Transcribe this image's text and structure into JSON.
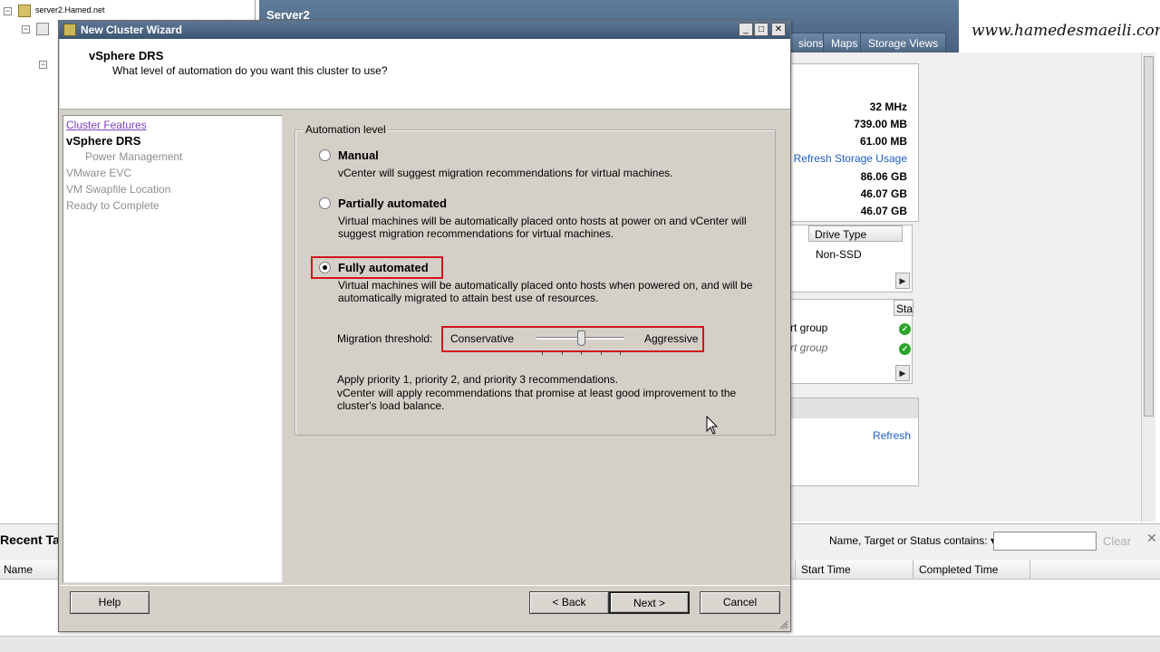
{
  "background": {
    "tree": {
      "root_label": "server2.Hamed.net"
    },
    "server_title": "Server2",
    "tabs": [
      "sions",
      "Maps",
      "Storage Views"
    ],
    "watermark": "www.hamedesmaeili.com",
    "resources": [
      "32 MHz",
      "739.00 MB",
      "61.00 MB"
    ],
    "refresh_storage_usage": "Refresh Storage Usage",
    "storage": [
      "86.06 GB",
      "46.07 GB",
      "46.07 GB"
    ],
    "drive_type_header": "Drive Type",
    "drive_type_value": "Non-SSD",
    "status_header": "Sta",
    "port_groups": [
      "rt group",
      "rt group"
    ],
    "refresh_link": "Refresh",
    "recent_tasks": {
      "title": "Recent Tas",
      "filter_label": "Name, Target or Status contains: ▾",
      "filter_value": "",
      "clear_label": "Clear",
      "columns": [
        "Name",
        "Start Time",
        "Completed Time"
      ]
    }
  },
  "wizard": {
    "title": "New Cluster Wizard",
    "window_buttons": {
      "minimize": "_",
      "maximize": "□",
      "close": "✕"
    },
    "header": {
      "title": "vSphere DRS",
      "subtitle": "What level of automation do you want this cluster to use?"
    },
    "steps": [
      {
        "label": "Cluster Features",
        "state": "done"
      },
      {
        "label": "vSphere DRS",
        "state": "current"
      },
      {
        "label": "Power Management",
        "state": "future"
      },
      {
        "label": "VMware EVC",
        "state": "future"
      },
      {
        "label": "VM Swapfile Location",
        "state": "future"
      },
      {
        "label": "Ready to Complete",
        "state": "future"
      }
    ],
    "automation": {
      "group_label": "Automation level",
      "options": [
        {
          "label": "Manual",
          "selected": false,
          "description": [
            "vCenter will suggest migration recommendations for virtual machines."
          ]
        },
        {
          "label": "Partially automated",
          "selected": false,
          "description": [
            "Virtual machines will be automatically placed onto hosts at power on and vCenter will",
            "suggest migration recommendations for virtual machines."
          ]
        },
        {
          "label": "Fully automated",
          "selected": true,
          "description": [
            "Virtual machines will be automatically placed onto hosts when powered on, and will be",
            "automatically migrated to attain best use of resources."
          ]
        }
      ],
      "threshold": {
        "label": "Migration threshold:",
        "min_label": "Conservative",
        "max_label": "Aggressive",
        "level": 3,
        "levels": 5
      },
      "threshold_description": [
        "Apply priority 1, priority 2, and priority 3 recommendations.",
        "vCenter will apply recommendations that promise at least good improvement to the",
        "cluster's load balance."
      ]
    },
    "buttons": {
      "help": "Help",
      "back": "< Back",
      "next": "Next >",
      "cancel": "Cancel"
    },
    "highlight_color": "#d3151b"
  }
}
